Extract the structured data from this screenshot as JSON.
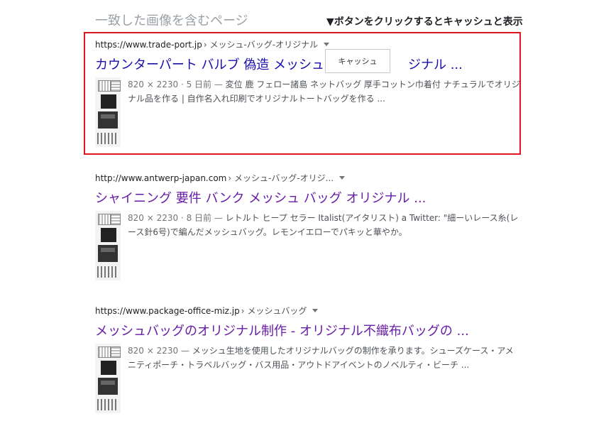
{
  "page": {
    "section_title": "一致した画像を含むページ",
    "instruction": "▼ボタンをクリックするとキャッシュと表示"
  },
  "cache_popup": {
    "label": "キャッシュ"
  },
  "colors": {
    "highlight_border": "#e0141e",
    "link_blue": "#1a0dab",
    "link_visited": "#681da8"
  },
  "results": [
    {
      "domain": "https://www.trade-port.jp",
      "path": "› メッシュ-バッグ-オリジナル",
      "title": "カウンターパート バルブ 偽造 メッシュ",
      "title_tail": "ジナル ...",
      "meta": "820 × 2230 · 5 日前 — ",
      "snippet": "変位 鹿 フェロー諸島 ネットバッグ 厚手コットン巾着付 ナチュラルでオリジナル品を作る | 自作名入れ印刷でオリジナルトートバッグを作る ..."
    },
    {
      "domain": "http://www.antwerp-japan.com",
      "path": "› メッシュ-バッグ-オリジ...",
      "title": "シャイニング 要件 バンク メッシュ バッグ オリジナル ...",
      "meta": "820 × 2230 · 8 日前 — ",
      "snippet": "レトルト ヒープ セラー Italist(アイタリスト) a Twitter: \"細ーいレース糸(レース針6号)で編んだメッシュバッグ。レモンイエローでパキッと華やか。"
    },
    {
      "domain": "https://www.package-office-miz.jp",
      "path": "› メッシュバッグ",
      "title": "メッシュバッグのオリジナル制作 - オリジナル不織布バッグの ...",
      "meta": "820 × 2230 — ",
      "snippet": "メッシュ生地を使用したオリジナルバッグの制作を承ります。シューズケース・アメニティポーチ・トラベルバッグ・バス用品・アウトドアイベントのノベルティ・ビーチ ..."
    }
  ]
}
